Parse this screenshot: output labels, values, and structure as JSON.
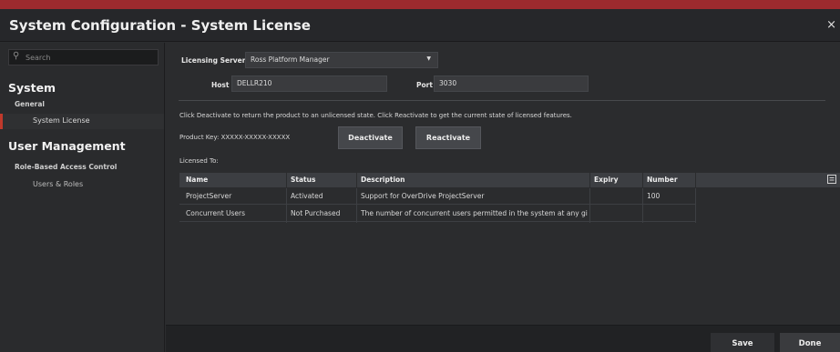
{
  "window": {
    "title": "System Configuration - System License",
    "close_glyph": "×"
  },
  "sidebar": {
    "search": {
      "placeholder": "Search",
      "icon": "search-icon"
    },
    "sections": [
      {
        "label": "System",
        "groups": [
          {
            "label": "General",
            "items": [
              {
                "label": "System License",
                "active": true
              }
            ]
          }
        ]
      },
      {
        "label": "User Management",
        "groups": [
          {
            "label": "Role-Based Access Control",
            "items": [
              {
                "label": "Users & Roles",
                "active": false
              }
            ]
          }
        ]
      }
    ]
  },
  "server": {
    "licensing_label": "Licensing Server",
    "licensing_value": "Ross Platform Manager",
    "host_label": "Host",
    "host_value": "DELLR210",
    "port_label": "Port",
    "port_value": "3030"
  },
  "license": {
    "instructions": "Click Deactivate to return the product to an unlicensed state. Click Reactivate to get the current state of licensed features.",
    "product_key": "Product Key: XXXXX-XXXXX-XXXXX",
    "deactivate_label": "Deactivate",
    "reactivate_label": "Reactivate",
    "licensed_to": "Licensed To:"
  },
  "table": {
    "columns": [
      "Name",
      "Status",
      "Description",
      "Expiry",
      "Number"
    ],
    "rows": [
      [
        "ProjectServer",
        "Activated",
        "Support for OverDrive ProjectServer",
        "",
        "100"
      ],
      [
        "Concurrent Users",
        "Not Purchased",
        "The number of concurrent users permitted in the system at any given time",
        "",
        ""
      ]
    ]
  },
  "footer": {
    "save_label": "Save",
    "done_label": "Done"
  },
  "colors": {
    "accent": "#9d2a2e",
    "active_marker": "#c0392b",
    "background": "#2b2c2e"
  }
}
